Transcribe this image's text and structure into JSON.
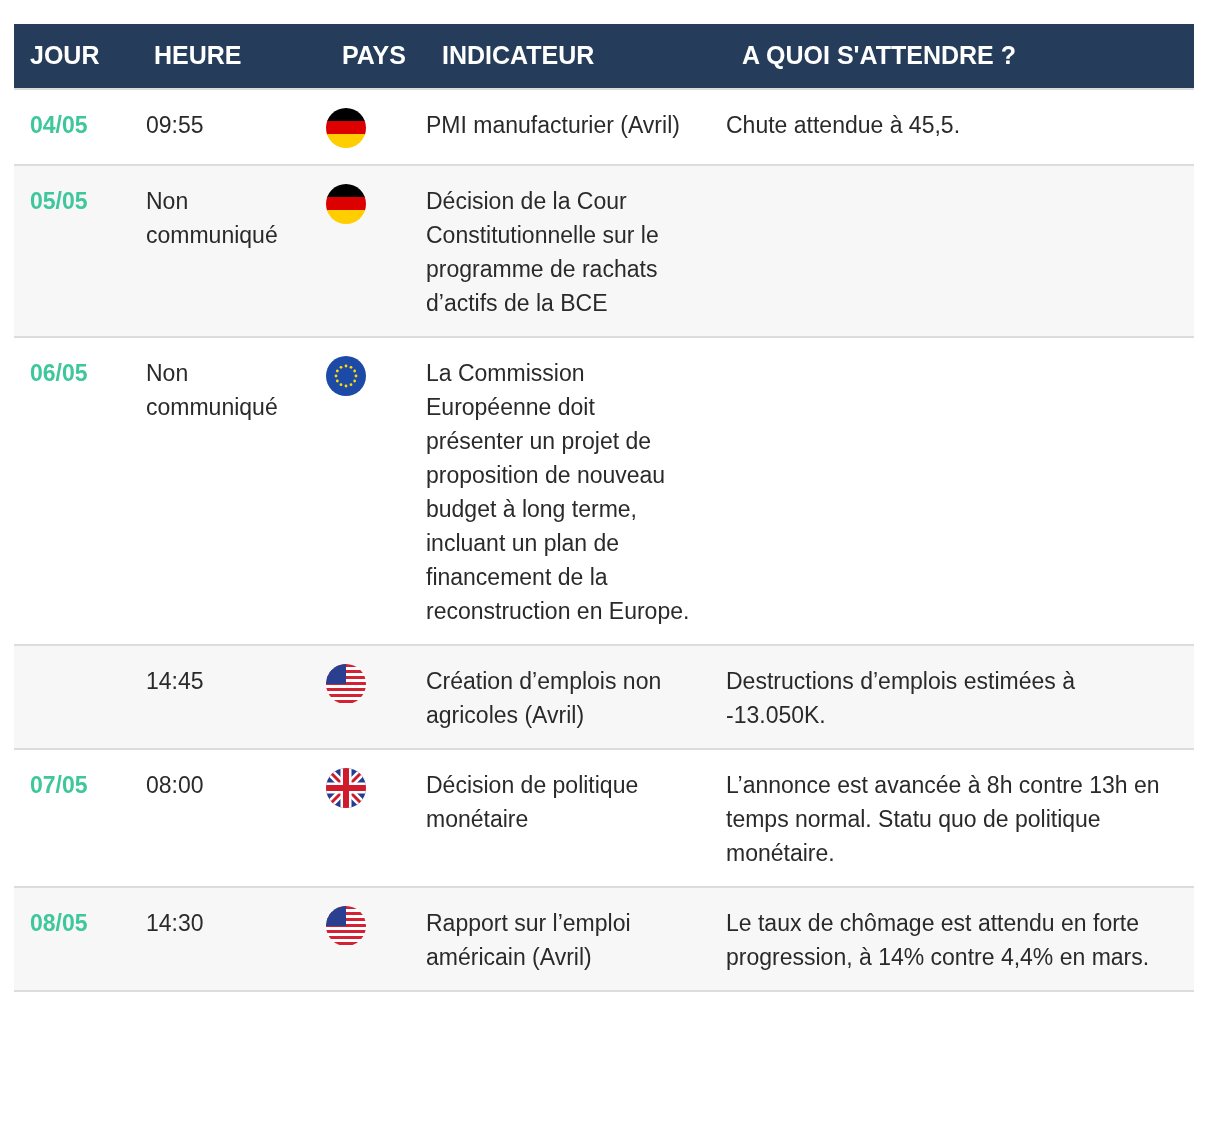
{
  "table": {
    "columns": [
      "JOUR",
      "HEURE",
      "PAYS",
      "INDICATEUR",
      "A QUOI S'ATTENDRE ?"
    ],
    "rows": [
      {
        "day": "04/05",
        "time": "09:55",
        "kind": "germany",
        "indicator": "PMI manufacturier (Avril)",
        "expectation": "Chute attendue à 45,5."
      },
      {
        "day": "05/05",
        "time": "Non communiqué",
        "kind": "germany",
        "indicator": "Décision de la Cour Constitutionnelle sur le programme de rachats d’actifs de la BCE"
      },
      {
        "day": "06/05",
        "time": "Non communiqué",
        "kind": "eu",
        "indicator": "La Commission Européenne doit présenter un projet de proposition de nouveau budget à long terme, incluant un plan de financement de la reconstruction en Europe."
      },
      {
        "time": "14:45",
        "kind": "usa",
        "indicator": "Création d’emplois non agricoles (Avril)",
        "expectation": "Destructions d’emplois estimées à -13.050K."
      },
      {
        "day": "07/05",
        "time": "08:00",
        "kind": "uk",
        "indicator": "Décision de politique monétaire",
        "expectation": "L’annonce est avancée à 8h contre 13h en temps normal. Statu quo de politique monétaire."
      },
      {
        "day": "08/05",
        "time": "14:30",
        "kind": "usa",
        "indicator": "Rapport sur l’emploi américain (Avril)",
        "expectation": "Le taux de chômage est attendu en forte progression, à 14% contre 4,4% en mars."
      }
    ]
  }
}
